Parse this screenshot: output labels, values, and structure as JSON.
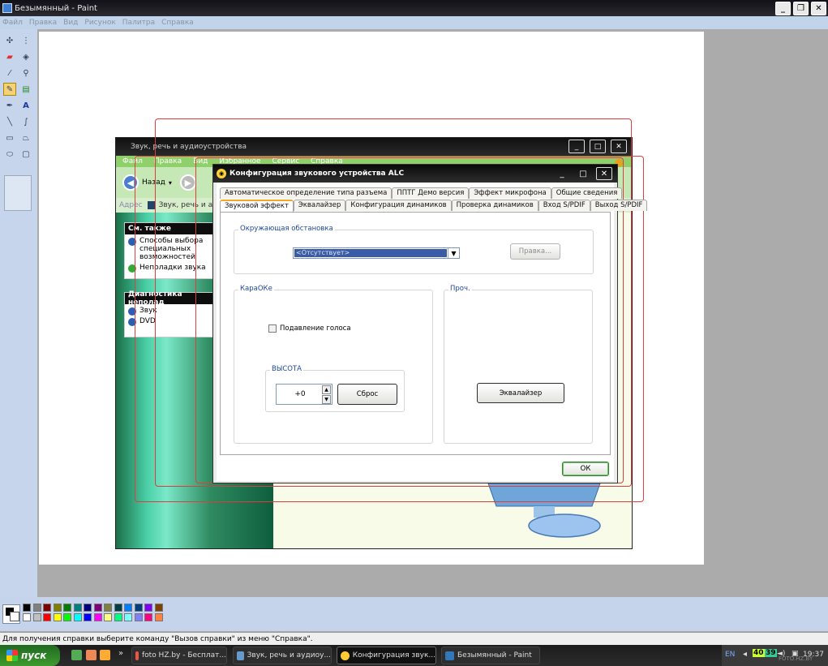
{
  "paint": {
    "title": "Безымянный - Paint",
    "menu": [
      "Файл",
      "Правка",
      "Вид",
      "Рисунок",
      "Палитра",
      "Справка"
    ],
    "controls": {
      "minimize": "_",
      "maximize": "❐",
      "close": "✕"
    },
    "status_text": "Для получения справки выберите команду \"Вызов справки\" из меню \"Справка\"."
  },
  "inner_window": {
    "title": "Звук, речь и аудиоустройства",
    "menu": [
      "Файл",
      "Правка",
      "Вид",
      "Избранное",
      "Сервис",
      "Справка"
    ],
    "back_label": "Назад",
    "address_label": "Адрес",
    "address_value": "Звук, речь и ау",
    "address_extra": "ре",
    "see_also_title": "См. также",
    "see_also_items": [
      "Способы выбора специальных возможностей",
      "Неполадки звука"
    ],
    "trouble_title": "Диагностика неполад",
    "trouble_items": [
      "Звук",
      "DVD"
    ]
  },
  "dialog": {
    "title": "Конфигурация звукового устройства ALC",
    "tabs_top": [
      "Автоматическое определение типа разъема",
      "ППТГ Демо версия",
      "Эффект микрофона",
      "Общие сведения"
    ],
    "tabs_bottom": [
      "Звуковой эффект",
      "Эквалайзер",
      "Конфигурация динамиков",
      "Проверка динамиков",
      "Вход S/PDIF",
      "Выход S/PDIF"
    ],
    "env_group_label": "Окружающая обстановка",
    "env_selected": "<Отсутствует>",
    "edit_button": "Правка...",
    "karaoke_label": "КараОКе",
    "voice_cancel_label": "Подавление голоса",
    "pitch_label": "ВЫСОТА",
    "pitch_value": "+0",
    "reset_button": "Сброс",
    "eq_group_label": "Проч.",
    "equalizer_button": "Эквалайзер",
    "ok_button": "ОК"
  },
  "palette": {
    "colors_top": [
      "#000000",
      "#808080",
      "#800000",
      "#808000",
      "#008000",
      "#008080",
      "#000080",
      "#800080",
      "#808040",
      "#004040",
      "#0080ff",
      "#004080",
      "#8000ff",
      "#804000"
    ],
    "colors_bottom": [
      "#ffffff",
      "#c0c0c0",
      "#ff0000",
      "#ffff00",
      "#00ff00",
      "#00ffff",
      "#0000ff",
      "#ff00ff",
      "#ffff80",
      "#00ff80",
      "#80ffff",
      "#8080ff",
      "#ff0080",
      "#ff8040"
    ]
  },
  "taskbar": {
    "start": "пуск",
    "more": "»",
    "tasks": [
      "foto HZ.by - Бесплат...",
      "Звук, речь и аудиоу...",
      "Конфигурация звук...",
      "Безымянный - Paint"
    ],
    "lang": "EN",
    "tray_a": "40",
    "tray_b": "39",
    "time": "19:37",
    "watermark": "FOTO.HZ.BY"
  },
  "colors": {
    "accent": "#f5a623",
    "selection": "#3a5ca6",
    "taskbar": "#1c1c1c"
  }
}
